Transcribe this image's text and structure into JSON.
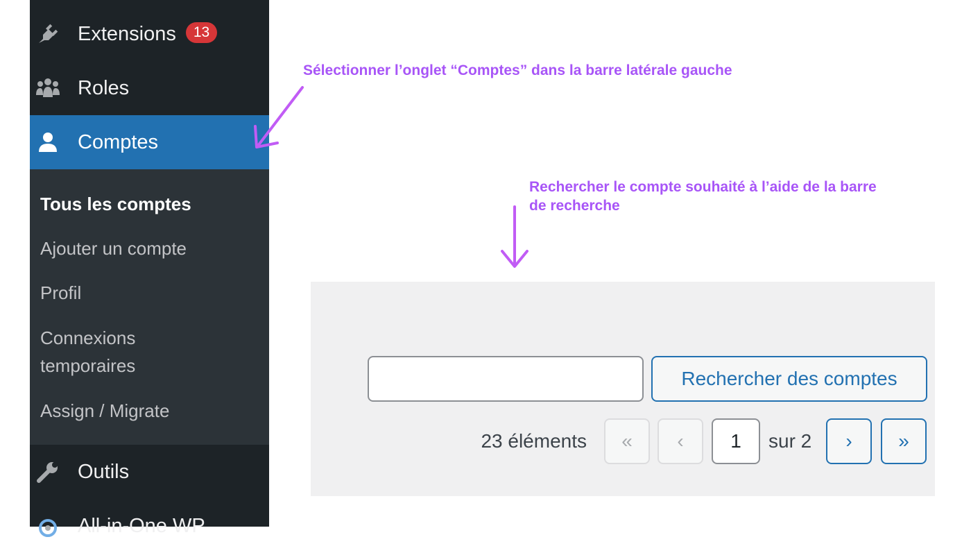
{
  "sidebar": {
    "items": [
      {
        "label": "Extensions",
        "badge": "13",
        "icon": "plugin-icon"
      },
      {
        "label": "Roles",
        "icon": "groups-icon"
      },
      {
        "label": "Comptes",
        "icon": "user-icon"
      },
      {
        "label": "Outils",
        "icon": "wrench-icon"
      },
      {
        "label": "All-in-One WP",
        "icon": "migration-icon"
      }
    ],
    "submenu": [
      "Tous les comptes",
      "Ajouter un compte",
      "Profil",
      "Connexions",
      "temporaires",
      "Assign / Migrate"
    ]
  },
  "annotations": {
    "first": "Sélectionner l’onglet “Comptes” dans la barre latérale gauche",
    "second_line1": "Rechercher le compte souhaité à l’aide de la barre",
    "second_line2": "de recherche"
  },
  "search": {
    "value": "",
    "button_label": "Rechercher des comptes"
  },
  "pagination": {
    "count": "23 éléments",
    "first": "«",
    "prev": "‹",
    "current_page": "1",
    "of_text": "sur 2",
    "next": "›",
    "last": "»"
  },
  "colors": {
    "accent": "#2271b1",
    "sidebar": "#1d2327",
    "annotation": "#a855f7",
    "badge": "#d63638"
  }
}
